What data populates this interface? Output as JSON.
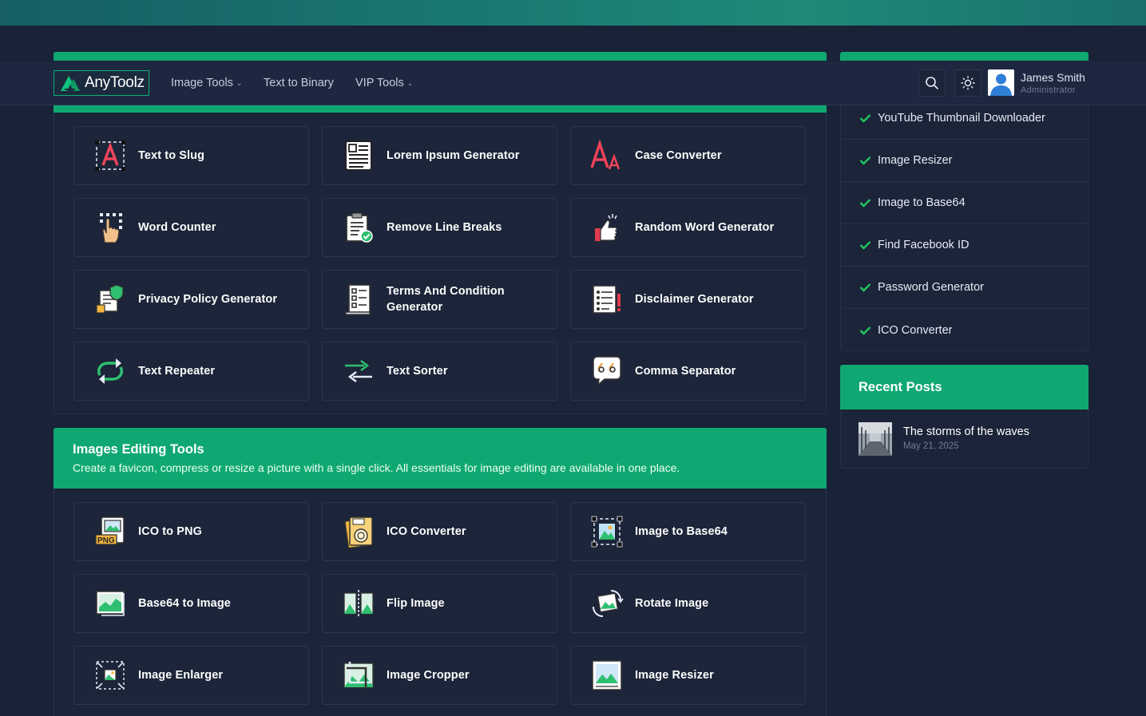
{
  "brand": {
    "name": "AnyToolz"
  },
  "nav": {
    "links": [
      {
        "label": "Image Tools",
        "dropdown": true
      },
      {
        "label": "Text to Binary",
        "dropdown": false
      },
      {
        "label": "VIP Tools",
        "dropdown": true
      }
    ],
    "search_icon": "search-icon",
    "theme_icon": "sun-icon"
  },
  "user": {
    "name": "James Smith",
    "role": "Administrator"
  },
  "text_tools": [
    {
      "label": "Text to Slug",
      "icon": "text-slug-icon"
    },
    {
      "label": "Lorem Ipsum Generator",
      "icon": "document-icon"
    },
    {
      "label": "Case Converter",
      "icon": "case-icon"
    },
    {
      "label": "Word Counter",
      "icon": "hand-pointer-icon"
    },
    {
      "label": "Remove Line Breaks",
      "icon": "clipboard-check-icon"
    },
    {
      "label": "Random Word Generator",
      "icon": "thumbs-up-icon"
    },
    {
      "label": "Privacy Policy Generator",
      "icon": "shield-document-icon"
    },
    {
      "label": "Terms And Condition Generator",
      "icon": "checklist-icon"
    },
    {
      "label": "Disclaimer Generator",
      "icon": "list-document-icon"
    },
    {
      "label": "Text Repeater",
      "icon": "repeat-icon"
    },
    {
      "label": "Text Sorter",
      "icon": "sort-arrows-icon"
    },
    {
      "label": "Comma Separator",
      "icon": "quote-bubble-icon"
    }
  ],
  "image_section": {
    "title": "Images Editing Tools",
    "description": "Create a favicon, compress or resize a picture with a single click. All essentials for image editing are available in one place."
  },
  "image_tools": [
    {
      "label": "ICO to PNG",
      "icon": "png-file-icon"
    },
    {
      "label": "ICO Converter",
      "icon": "ico-file-icon"
    },
    {
      "label": "Image to Base64",
      "icon": "image-select-icon"
    },
    {
      "label": "Base64 to Image",
      "icon": "image-chart-icon"
    },
    {
      "label": "Flip Image",
      "icon": "flip-icon"
    },
    {
      "label": "Rotate Image",
      "icon": "rotate-icon"
    },
    {
      "label": "Image Enlarger",
      "icon": "enlarge-icon"
    },
    {
      "label": "Image Cropper",
      "icon": "crop-icon"
    },
    {
      "label": "Image Resizer",
      "icon": "resize-icon"
    }
  ],
  "sidebar": {
    "popular": [
      "YouTube Thumbnail Downloader",
      "Image Resizer",
      "Image to Base64",
      "Find Facebook ID",
      "Password Generator",
      "ICO Converter"
    ],
    "recent_title": "Recent Posts",
    "posts": [
      {
        "title": "The storms of the waves",
        "date": "May 21, 2025"
      }
    ]
  },
  "colors": {
    "accent": "#10a872",
    "background": "#192236",
    "card": "#1c2539",
    "check": "#22c55e"
  }
}
